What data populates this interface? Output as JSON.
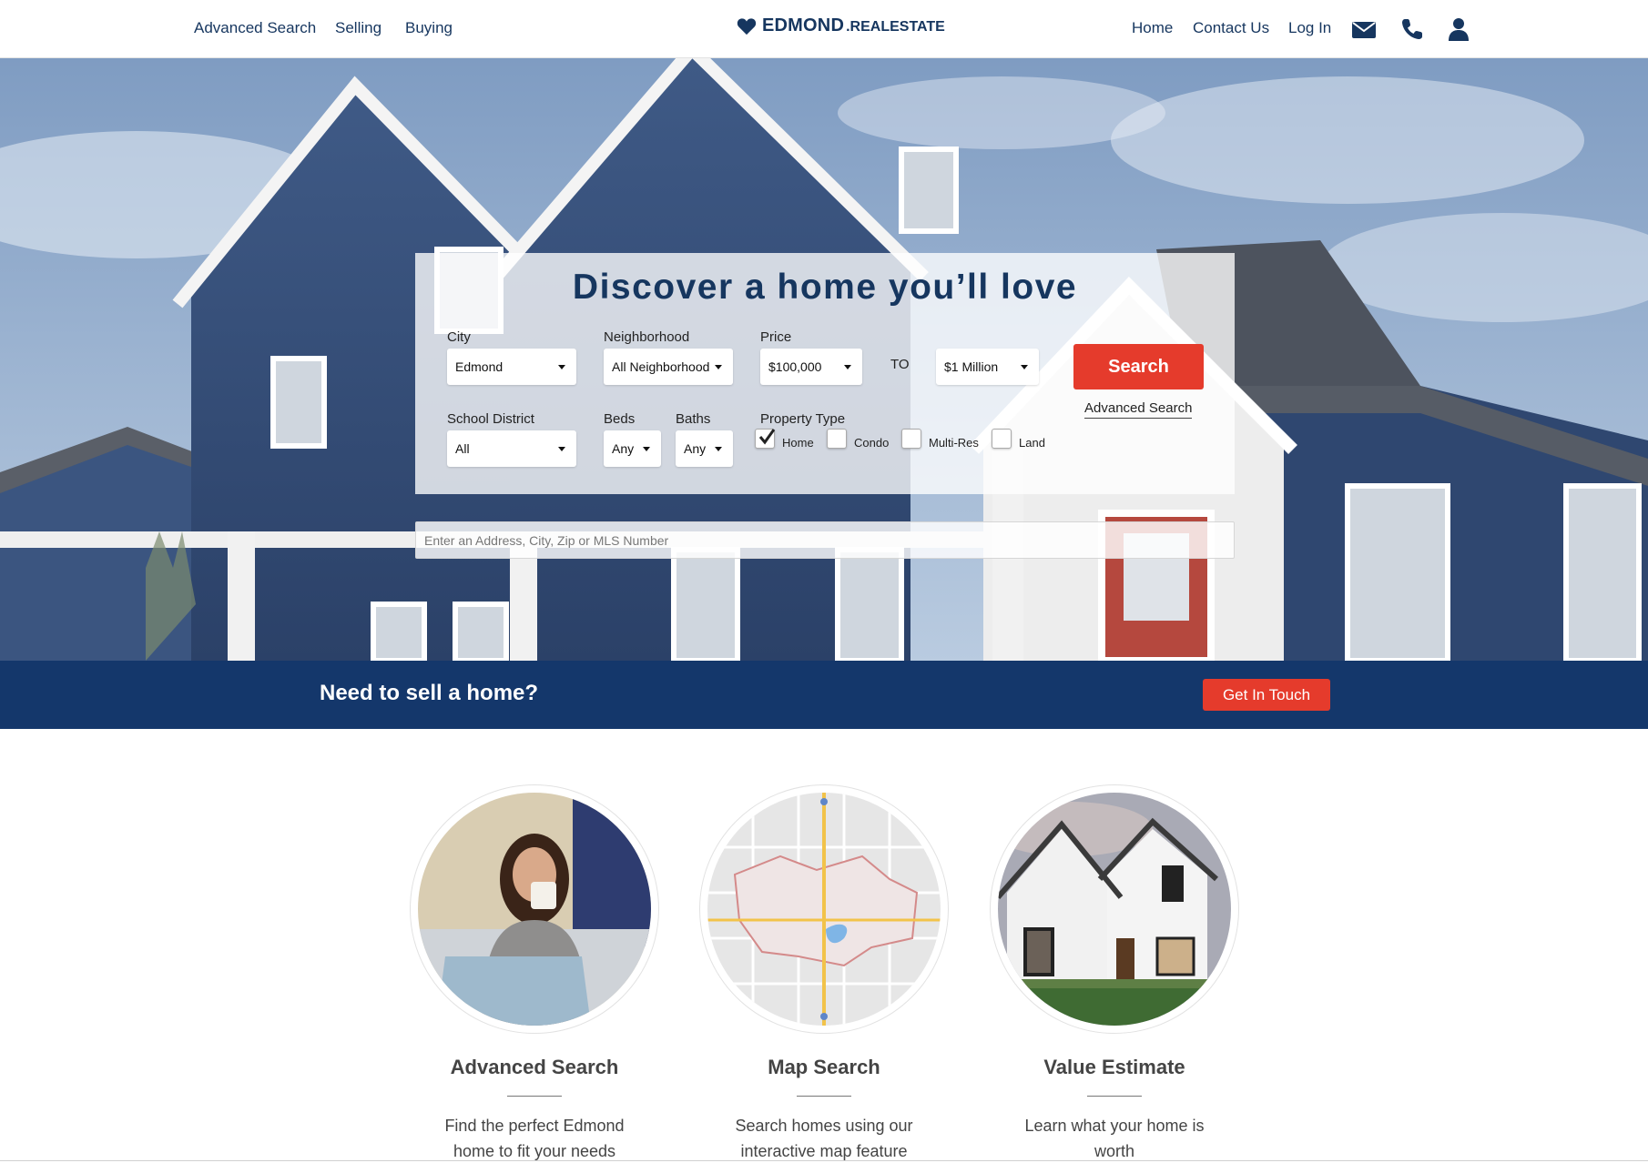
{
  "nav": {
    "left_links": [
      "Advanced Search",
      "Selling",
      "Buying"
    ],
    "brand_main": "EDMOND",
    "brand_suffix": ".REALESTATE",
    "right_links": [
      "Home",
      "Contact Us",
      "Log In"
    ],
    "icons": [
      "envelope-icon",
      "phone-icon",
      "user-icon"
    ]
  },
  "search": {
    "title": "Discover a home you’ll love",
    "city": {
      "label": "City",
      "value": "Edmond"
    },
    "neighborhood": {
      "label": "Neighborhood",
      "value": "All Neighborhoods"
    },
    "price": {
      "label": "Price",
      "min": "$100,000",
      "to": "TO",
      "max": "$1 Million"
    },
    "search_button": "Search",
    "advanced_link": "Advanced Search",
    "school": {
      "label": "School District",
      "value": "All"
    },
    "beds": {
      "label": "Beds",
      "value": "Any"
    },
    "baths": {
      "label": "Baths",
      "value": "Any"
    },
    "property_type": {
      "label": "Property Type",
      "options": [
        {
          "label": "Home",
          "checked": true
        },
        {
          "label": "Condo",
          "checked": false
        },
        {
          "label": "Multi-Res",
          "checked": false
        },
        {
          "label": "Land",
          "checked": false
        }
      ]
    },
    "address_placeholder": "Enter an Address, City, Zip or MLS Number"
  },
  "sell_banner": {
    "text": "Need to sell a home?",
    "button": "Get In Touch"
  },
  "features": [
    {
      "title": "Advanced Search",
      "desc": "Find the perfect Edmond home to fit your needs"
    },
    {
      "title": "Map Search",
      "desc": "Search homes using our interactive map feature"
    },
    {
      "title": "Value Estimate",
      "desc": "Learn what your home is worth"
    }
  ],
  "colors": {
    "navy": "#16365f",
    "banner": "#14376b",
    "accent_red": "#e53b2c"
  }
}
